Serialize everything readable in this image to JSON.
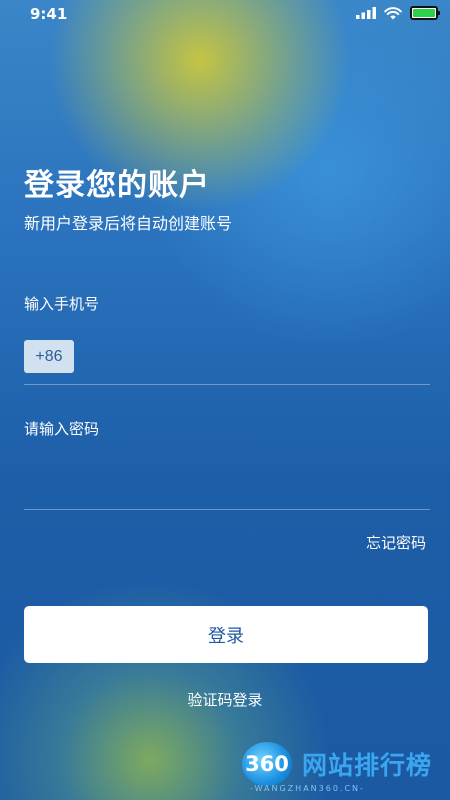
{
  "status_bar": {
    "time": "9:41",
    "signal_icon": "cellular-signal-icon",
    "wifi_icon": "wifi-icon",
    "battery_icon": "battery-icon",
    "battery_level": 1.0,
    "battery_color": "#2bd14a"
  },
  "header": {
    "title": "登录您的账户",
    "subtitle": "新用户登录后将自动创建账号"
  },
  "phone": {
    "label": "输入手机号",
    "country_code": "+86",
    "value": ""
  },
  "password": {
    "placeholder": "请输入密码",
    "value": ""
  },
  "forgot_password": "忘记密码",
  "login_button": "登录",
  "sms_login": "验证码登录",
  "watermark": {
    "logo": "360",
    "text": "网站排行榜",
    "url": "-WANGZHAN360.CN-"
  },
  "colors": {
    "background": "#1e63ad",
    "button_text": "#1d5aa0",
    "button_bg": "#ffffff"
  }
}
